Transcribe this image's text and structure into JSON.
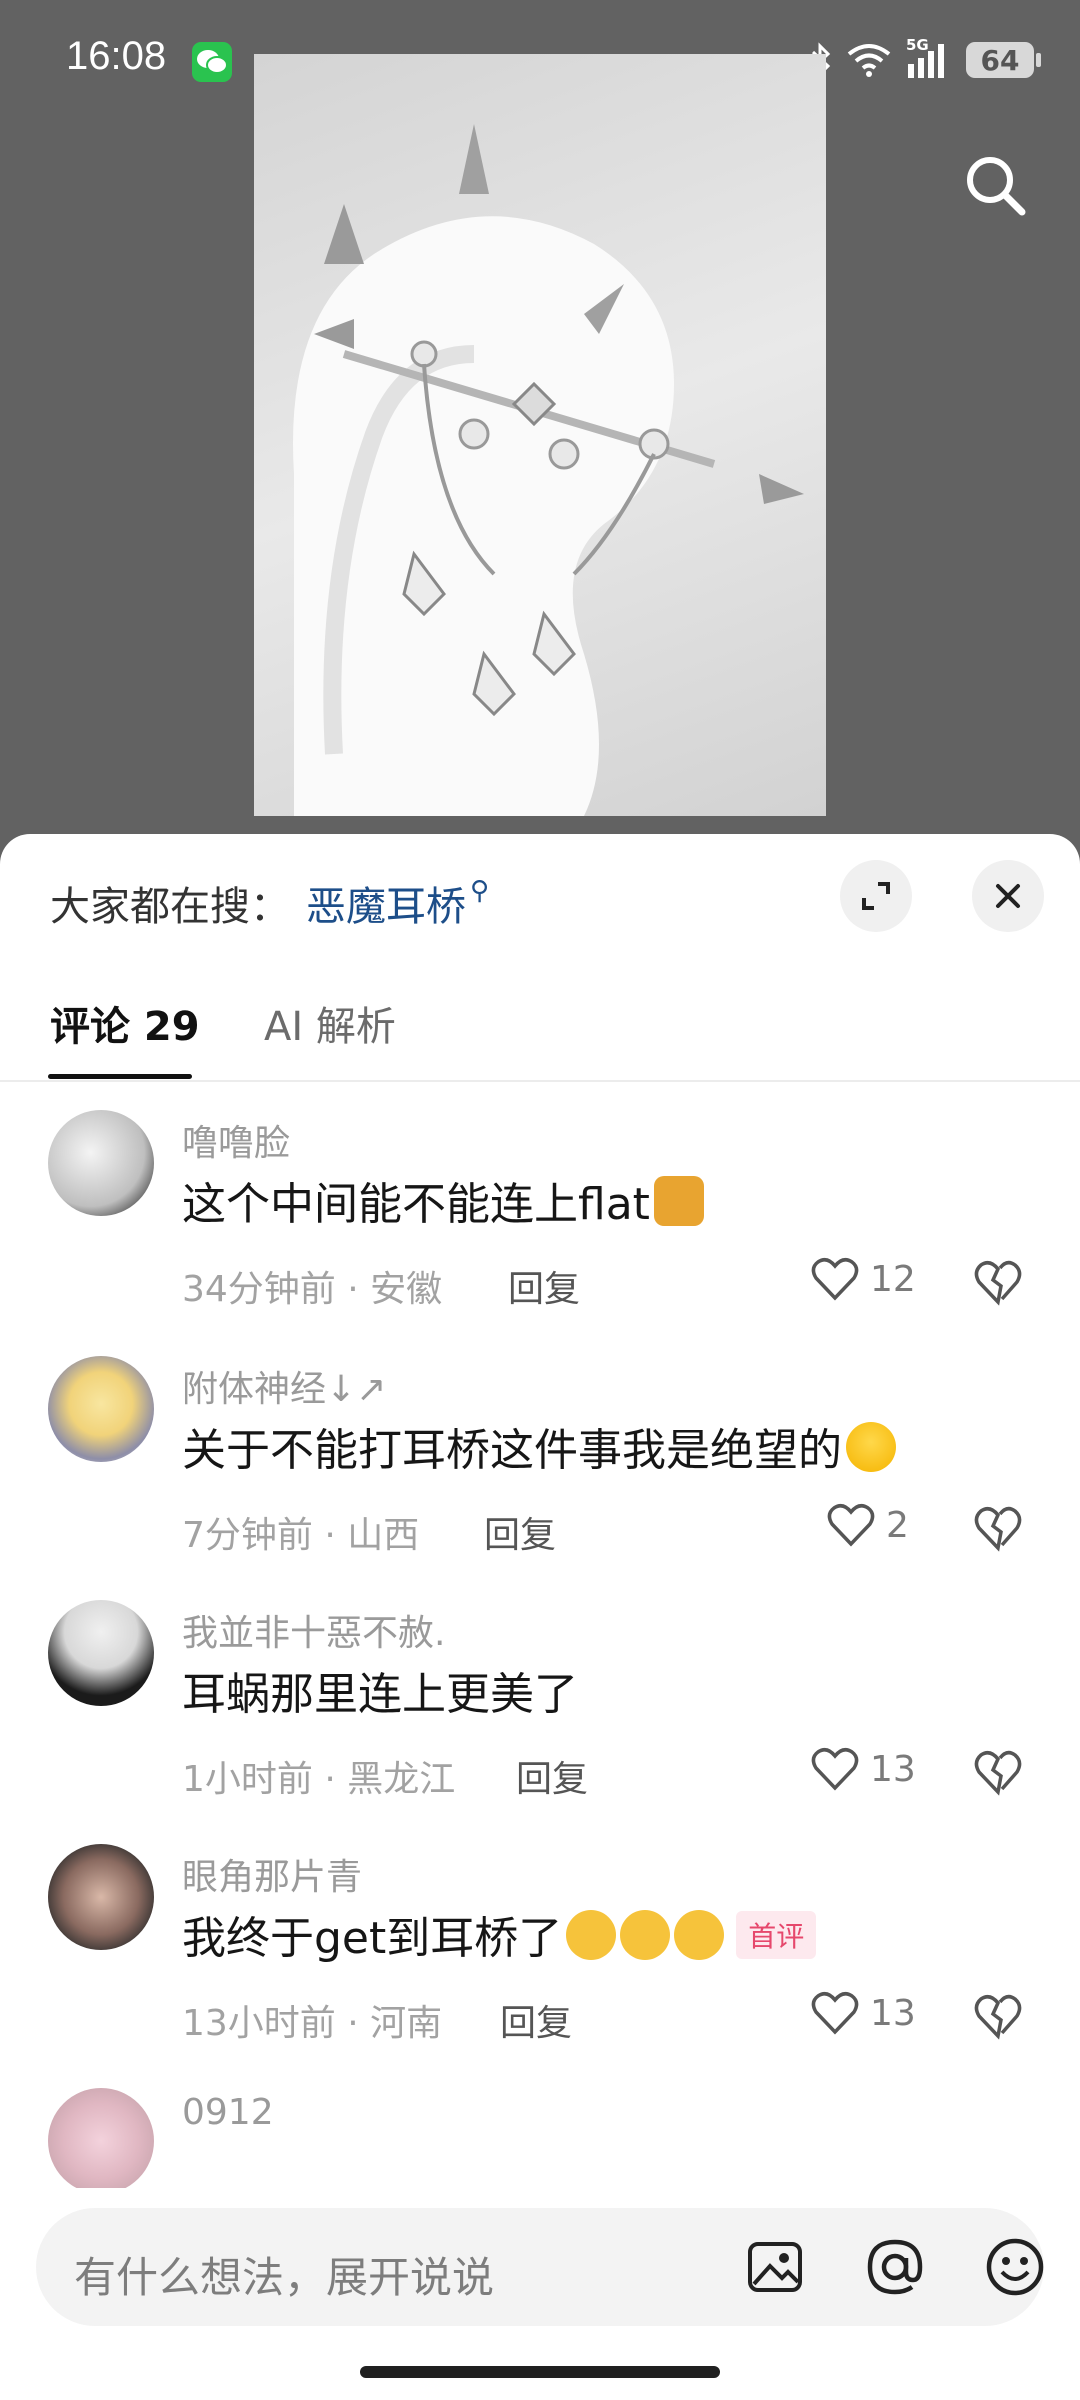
{
  "status_bar": {
    "time": "16:08",
    "network": "5G",
    "battery": "64"
  },
  "search_bar": {
    "label": "大家都在搜：",
    "term": "恶魔耳桥"
  },
  "tabs": [
    {
      "label": "评论 29"
    },
    {
      "label": "AI 解析"
    }
  ],
  "comments": [
    {
      "user": "噜噜脸",
      "text": "这个中间能不能连上flat",
      "time": "34分钟前 · 安徽",
      "reply": "回复",
      "likes": "12"
    },
    {
      "user": "附体神经↓↗",
      "text": "关于不能打耳桥这件事我是绝望的",
      "time": "7分钟前 · 山西",
      "reply": "回复",
      "likes": "2"
    },
    {
      "user": "我並非十惡不赦.",
      "text": "耳蜗那里连上更美了",
      "time": "1小时前 · 黑龙江",
      "reply": "回复",
      "likes": "13"
    },
    {
      "user": "眼角那片青",
      "text": "我终于get到耳桥了",
      "badge": "首评",
      "time": "13小时前 · 河南",
      "reply": "回复",
      "likes": "13"
    },
    {
      "user": "0912",
      "text": ""
    }
  ],
  "input": {
    "placeholder": "有什么想法，展开说说"
  },
  "colors": {
    "accent_link": "#1d4e89",
    "badge_text": "#e6486c"
  },
  "icons": [
    "wechat-icon",
    "bluetooth-icon",
    "wifi-icon",
    "signal-icon",
    "battery-icon",
    "search-icon",
    "expand-icon",
    "close-icon",
    "heart-icon",
    "broken-heart-icon",
    "image-icon",
    "at-icon",
    "emoji-icon"
  ]
}
